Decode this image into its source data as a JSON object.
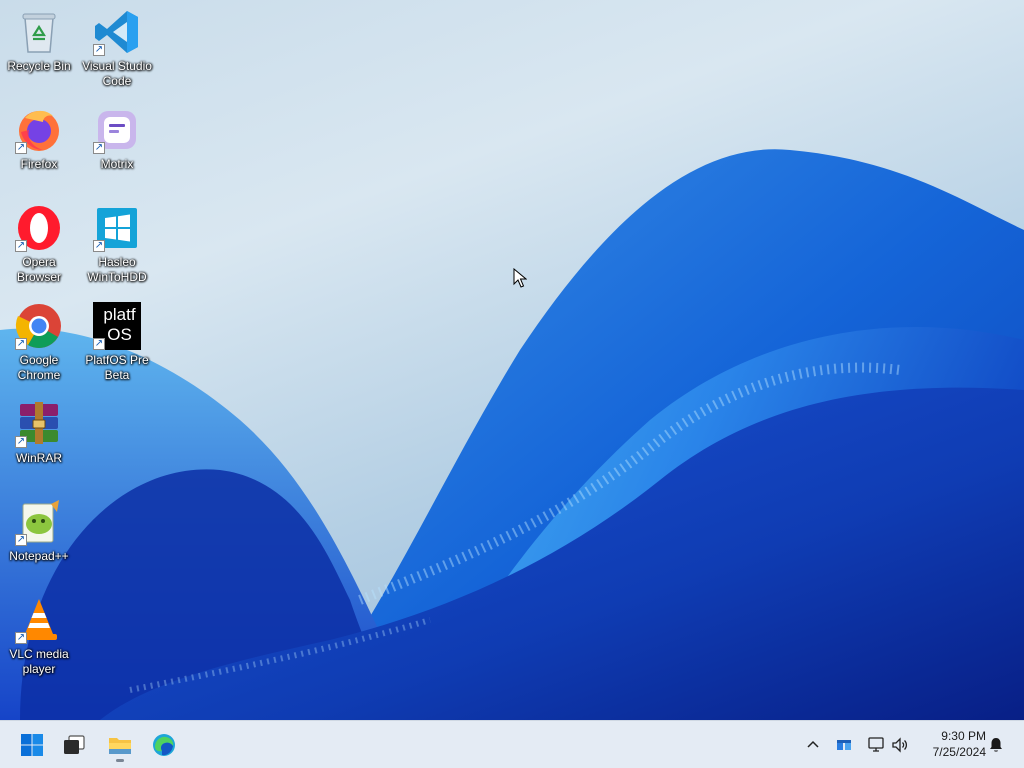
{
  "desktop": {
    "icons": [
      {
        "label": "Recycle Bin",
        "icon": "recycle-bin-icon"
      },
      {
        "label": "Visual Studio\nCode",
        "icon": "vscode-icon"
      },
      {
        "label": "Firefox",
        "icon": "firefox-icon"
      },
      {
        "label": "Motrix",
        "icon": "motrix-icon"
      },
      {
        "label": "Opera\nBrowser",
        "icon": "opera-icon"
      },
      {
        "label": "Hasleo\nWinToHDD",
        "icon": "wintohdd-icon"
      },
      {
        "label": "Google\nChrome",
        "icon": "chrome-icon"
      },
      {
        "label": "PlatfOS Pre\nBeta",
        "icon": "platfos-icon"
      },
      {
        "label": "WinRAR",
        "icon": "winrar-icon"
      },
      {
        "label": "Notepad++",
        "icon": "notepadpp-icon"
      },
      {
        "label": "VLC media\nplayer",
        "icon": "vlc-icon"
      }
    ],
    "platfos_logo_text": "platf OS",
    "shortcut_glyph": "↗"
  },
  "taskbar": {
    "pinned": [
      {
        "name": "Start",
        "icon": "windows-logo-icon"
      },
      {
        "name": "Task View",
        "icon": "task-view-icon"
      },
      {
        "name": "File Explorer",
        "icon": "folder-icon",
        "running": true
      },
      {
        "name": "Microsoft Edge",
        "icon": "edge-icon"
      }
    ],
    "tray": {
      "icons": [
        "chevron-up-icon",
        "security-icon",
        "network-icon",
        "volume-icon",
        "notification-bell-icon"
      ]
    },
    "clock": {
      "time": "9:30 PM",
      "date": "7/25/2024"
    }
  },
  "colors": {
    "accent": "#0a5cd6",
    "taskbar_bg": "#e4ebf4",
    "wallpaper_blue": "#1e5fe0"
  }
}
